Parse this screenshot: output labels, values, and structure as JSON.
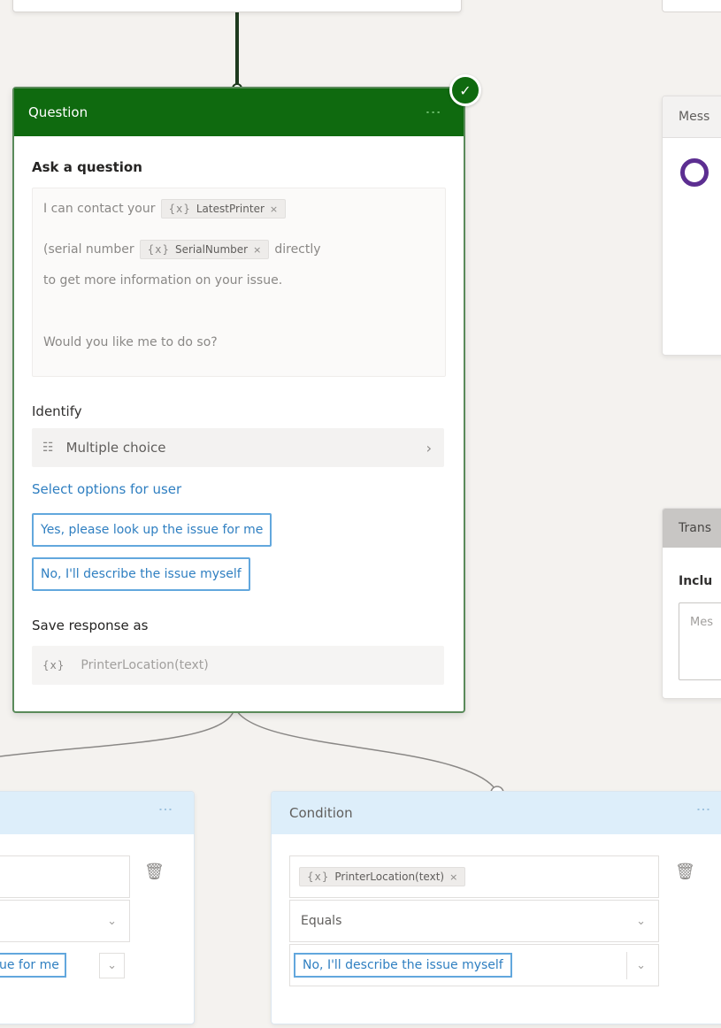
{
  "question_node": {
    "header": "Question",
    "ask_label": "Ask a question",
    "message": {
      "line1_text": "I can contact your",
      "var1": "LatestPrinter",
      "line2_text": "(serial number",
      "var2": "SerialNumber",
      "line2_tail": "directly",
      "line3_text": "to get more information on your issue.",
      "line4_text": "Would you like me to do so?"
    },
    "identify_label": "Identify",
    "identify_value": "Multiple choice",
    "select_options_link": "Select options for user",
    "options": [
      "Yes, please look up the issue for me",
      "No, I'll describe the issue myself"
    ],
    "save_label": "Save response as",
    "save_variable": "PrinterLocation(text)"
  },
  "message_node": {
    "header": "Mess"
  },
  "transfer_node": {
    "header": "Trans",
    "include_label": "Inclu",
    "box_placeholder": "Mes"
  },
  "condition_left": {
    "option_value": "ue for me"
  },
  "condition_right": {
    "header": "Condition",
    "variable": "PrinterLocation(text)",
    "operator": "Equals",
    "value": "No, I'll describe the issue myself"
  },
  "icons": {
    "var": "{x}",
    "close": "×",
    "chevron": "›",
    "caret": "⌄",
    "trash": "🗑",
    "check": "✓",
    "kebab": "⋮"
  },
  "colors": {
    "question_header": "#0f6a0f",
    "link": "#2f7fc1",
    "condition_header": "#ddeefa",
    "message_icon": "#5c2e91"
  }
}
